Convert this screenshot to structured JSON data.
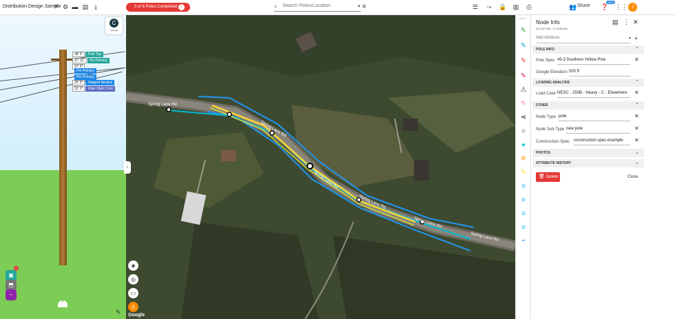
{
  "topbar": {
    "project_name": "Distribution Design Sample",
    "progress": "0 of 6 Poles Completed",
    "progress_info": "i",
    "search_placeholder": "Search Poles/Location",
    "share_label": "Share",
    "new_badge": "NEW",
    "avatar_initial": "J"
  },
  "left_panel": {
    "logo_letter": "C",
    "logo_sub": "example",
    "pole_labels": [
      {
        "height": "38' 6\"",
        "text": "Pole Top",
        "color": "#26a69a"
      },
      {
        "height": "37' 11\"",
        "text": "Pin     Primary",
        "color": "#26a69a"
      },
      {
        "height": "37' 0\"",
        "text": "",
        "color": "#26a69a"
      },
      {
        "height": "",
        "text": "Pin     Primary",
        "color": "#1e88e5"
      },
      {
        "height": "",
        "text": "Pin     Primary",
        "color": "#1e88e5"
      },
      {
        "height": "25' 8\"",
        "text": "Tangent   Neutral",
        "color": "#1e88e5"
      },
      {
        "height": "22' 3\"",
        "text": "Fiber Optic Com",
        "color": "#5c6bc0"
      }
    ],
    "fab_badge": "1"
  },
  "map": {
    "road_labels": [
      "Spring Lane Rd",
      "Spring Lane Rd",
      "Spring Lane Rd",
      "Spring Lane Rd",
      "Spring Lane Rd"
    ],
    "google_label": "Google"
  },
  "tools": {
    "title": "TOOLS",
    "colors": {
      "green": "#43a047",
      "cyan": "#00acc1",
      "red": "#e53935",
      "magenta": "#d81b60",
      "lightmagenta": "#f06292",
      "teal": "#26c6da",
      "orange": "#ffb74d",
      "yellow": "#fdd835",
      "blue": "#29b6f6"
    }
  },
  "panel": {
    "title": "Node Info",
    "coords": "40.1337098, -77.0251346",
    "add_attribute_placeholder": "Add Attribute",
    "sections": {
      "pole_info": "POLE INFO",
      "loading": "LOADING ANALYSIS",
      "other": "OTHER",
      "photos": "PHOTOS",
      "history": "ATTRIBUTE HISTORY"
    },
    "fields": {
      "pole_spec_label": "Pole Spec",
      "pole_spec_value": "45-3 Southern Yellow Pine",
      "google_elev_label": "Google Elevation",
      "google_elev_value": "500 ft",
      "load_case_label": "Load Case",
      "load_case_value": "NESC - 250B - Heavy - C - Elsewhere",
      "node_type_label": "Node Type",
      "node_type_value": "pole",
      "node_sub_label": "Node Sub Type",
      "node_sub_value": "new pole",
      "constr_label": "Construction Spec",
      "constr_value": "construction-spec-example"
    },
    "delete_label": "Delete",
    "close_label": "Close"
  }
}
